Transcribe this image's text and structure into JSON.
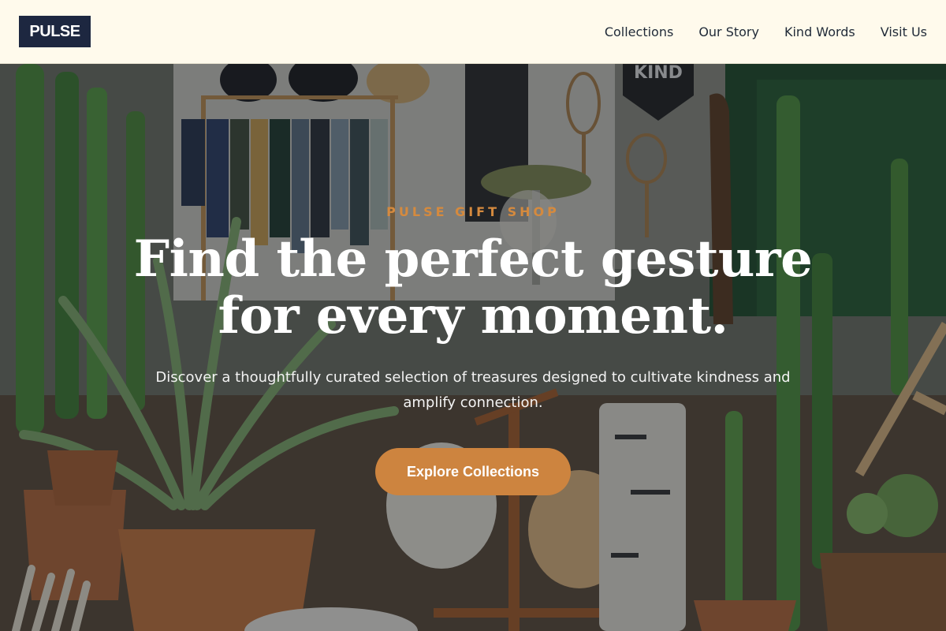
{
  "header": {
    "logo": "PULSE",
    "nav": [
      {
        "label": "Collections"
      },
      {
        "label": "Our Story"
      },
      {
        "label": "Kind Words"
      },
      {
        "label": "Visit Us"
      }
    ]
  },
  "hero": {
    "eyebrow": "PULSE GIFT SHOP",
    "headline_line1": "Find the perfect gesture",
    "headline_line2": "for every moment.",
    "subhead": "Discover a thoughtfully curated selection of treasures designed to cultivate kindness and amplify connection.",
    "cta_label": "Explore Collections",
    "background_description": "Gift shop interior with cacti, potted plants, clothing rack and wooden rackets",
    "accent_color": "#cd843f",
    "banner_text": "KIND"
  }
}
